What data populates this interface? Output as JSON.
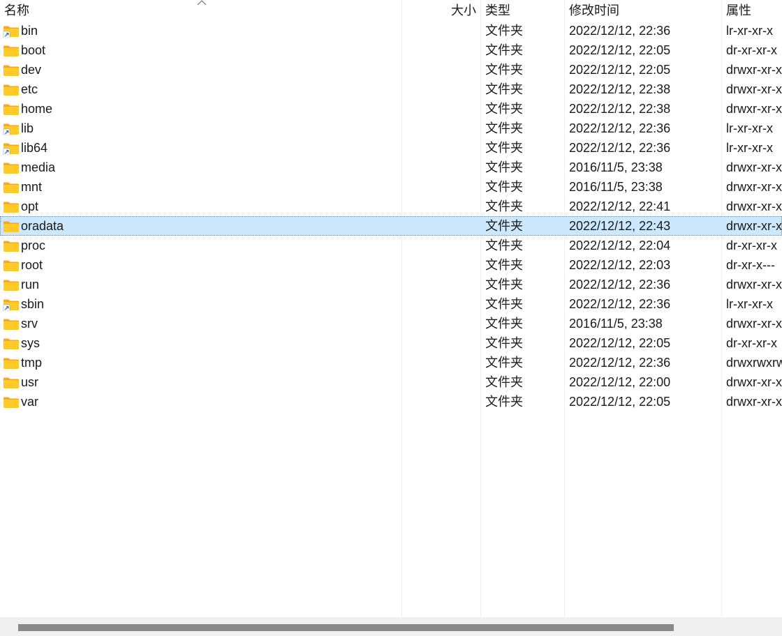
{
  "columns": {
    "name": "名称",
    "size": "大小",
    "type": "类型",
    "mtime": "修改时间",
    "attr": "属性"
  },
  "files": [
    {
      "name": "bin",
      "type": "文件夹",
      "mtime": "2022/12/12, 22:36",
      "attr": "lr-xr-xr-x",
      "icon": "folder-shortcut-icon",
      "selected": false
    },
    {
      "name": "boot",
      "type": "文件夹",
      "mtime": "2022/12/12, 22:05",
      "attr": "dr-xr-xr-x",
      "icon": "folder-icon",
      "selected": false
    },
    {
      "name": "dev",
      "type": "文件夹",
      "mtime": "2022/12/12, 22:05",
      "attr": "drwxr-xr-x",
      "icon": "folder-icon",
      "selected": false
    },
    {
      "name": "etc",
      "type": "文件夹",
      "mtime": "2022/12/12, 22:38",
      "attr": "drwxr-xr-x",
      "icon": "folder-icon",
      "selected": false
    },
    {
      "name": "home",
      "type": "文件夹",
      "mtime": "2022/12/12, 22:38",
      "attr": "drwxr-xr-x",
      "icon": "folder-icon",
      "selected": false
    },
    {
      "name": "lib",
      "type": "文件夹",
      "mtime": "2022/12/12, 22:36",
      "attr": "lr-xr-xr-x",
      "icon": "folder-shortcut-icon",
      "selected": false
    },
    {
      "name": "lib64",
      "type": "文件夹",
      "mtime": "2022/12/12, 22:36",
      "attr": "lr-xr-xr-x",
      "icon": "folder-shortcut-icon",
      "selected": false
    },
    {
      "name": "media",
      "type": "文件夹",
      "mtime": "2016/11/5, 23:38",
      "attr": "drwxr-xr-x",
      "icon": "folder-icon",
      "selected": false
    },
    {
      "name": "mnt",
      "type": "文件夹",
      "mtime": "2016/11/5, 23:38",
      "attr": "drwxr-xr-x",
      "icon": "folder-icon",
      "selected": false
    },
    {
      "name": "opt",
      "type": "文件夹",
      "mtime": "2022/12/12, 22:41",
      "attr": "drwxr-xr-x",
      "icon": "folder-icon",
      "selected": false
    },
    {
      "name": "oradata",
      "type": "文件夹",
      "mtime": "2022/12/12, 22:43",
      "attr": "drwxr-xr-x",
      "icon": "folder-icon",
      "selected": true
    },
    {
      "name": "proc",
      "type": "文件夹",
      "mtime": "2022/12/12, 22:04",
      "attr": "dr-xr-xr-x",
      "icon": "folder-icon",
      "selected": false
    },
    {
      "name": "root",
      "type": "文件夹",
      "mtime": "2022/12/12, 22:03",
      "attr": "dr-xr-x---",
      "icon": "folder-icon",
      "selected": false
    },
    {
      "name": "run",
      "type": "文件夹",
      "mtime": "2022/12/12, 22:36",
      "attr": "drwxr-xr-x",
      "icon": "folder-icon",
      "selected": false
    },
    {
      "name": "sbin",
      "type": "文件夹",
      "mtime": "2022/12/12, 22:36",
      "attr": "lr-xr-xr-x",
      "icon": "folder-shortcut-icon",
      "selected": false
    },
    {
      "name": "srv",
      "type": "文件夹",
      "mtime": "2016/11/5, 23:38",
      "attr": "drwxr-xr-x",
      "icon": "folder-icon",
      "selected": false
    },
    {
      "name": "sys",
      "type": "文件夹",
      "mtime": "2022/12/12, 22:05",
      "attr": "dr-xr-xr-x",
      "icon": "folder-icon",
      "selected": false
    },
    {
      "name": "tmp",
      "type": "文件夹",
      "mtime": "2022/12/12, 22:36",
      "attr": "drwxrwxrwt",
      "icon": "folder-icon",
      "selected": false
    },
    {
      "name": "usr",
      "type": "文件夹",
      "mtime": "2022/12/12, 22:00",
      "attr": "drwxr-xr-x",
      "icon": "folder-icon",
      "selected": false
    },
    {
      "name": "var",
      "type": "文件夹",
      "mtime": "2022/12/12, 22:05",
      "attr": "drwxr-xr-x",
      "icon": "folder-icon",
      "selected": false
    }
  ],
  "sort": {
    "column": "name",
    "direction": "ascending",
    "icon": "sort-ascending-icon"
  },
  "colors": {
    "selection": "#cce8ff",
    "selection_border": "#5a8ec2",
    "folder_body": "#ffca28",
    "folder_tab": "#f5a623",
    "shortcut_arrow": "#1e78d7",
    "scroll_track": "#efefef",
    "scroll_thumb": "#8a8a8a"
  }
}
